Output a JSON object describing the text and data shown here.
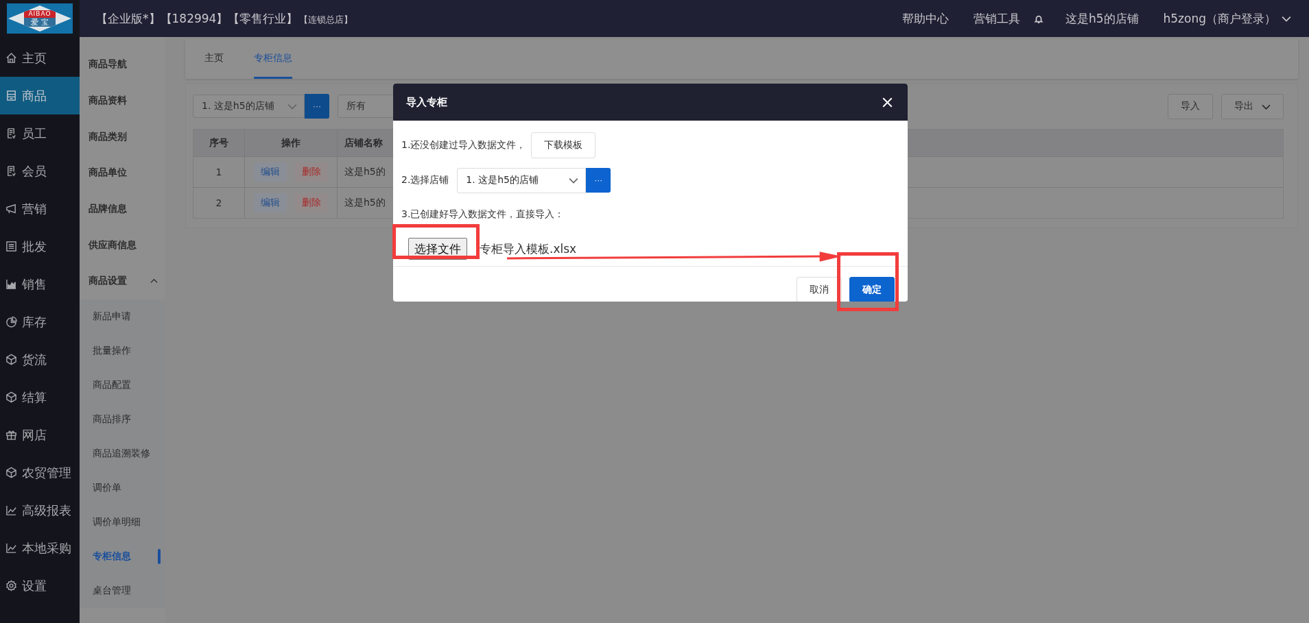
{
  "header": {
    "logo": {
      "top": "AIBAO",
      "bottom": "爱 宝"
    },
    "title_parts": [
      "【企业版*】",
      "【182994】",
      "【零售行业】"
    ],
    "title_note": "【连锁总店】",
    "links": [
      "帮助中心",
      "营销工具"
    ],
    "store": "这是h5的店铺",
    "user": "h5zong（商户登录）"
  },
  "nav": [
    {
      "label": "主页",
      "kind": "home",
      "selected": false
    },
    {
      "label": "商品",
      "kind": "box",
      "selected": true
    },
    {
      "label": "员工",
      "kind": "doc",
      "selected": false
    },
    {
      "label": "会员",
      "kind": "doc",
      "selected": false
    },
    {
      "label": "营销",
      "kind": "horn",
      "selected": false
    },
    {
      "label": "批发",
      "kind": "list",
      "selected": false
    },
    {
      "label": "销售",
      "kind": "area",
      "selected": false
    },
    {
      "label": "库存",
      "kind": "pie",
      "selected": false
    },
    {
      "label": "货流",
      "kind": "cube",
      "selected": false
    },
    {
      "label": "结算",
      "kind": "cube",
      "selected": false
    },
    {
      "label": "网店",
      "kind": "gift",
      "selected": false
    },
    {
      "label": "农贸管理",
      "kind": "cube",
      "selected": false
    },
    {
      "label": "高级报表",
      "kind": "line",
      "selected": false
    },
    {
      "label": "本地采购",
      "kind": "line",
      "selected": false
    },
    {
      "label": "设置",
      "kind": "gear",
      "selected": false
    }
  ],
  "subnav": [
    {
      "label": "商品导航",
      "selected": false
    },
    {
      "label": "商品资料",
      "selected": false
    },
    {
      "label": "商品类别",
      "selected": false
    },
    {
      "label": "商品单位",
      "selected": false
    },
    {
      "label": "品牌信息",
      "selected": false
    },
    {
      "label": "供应商信息",
      "selected": false
    },
    {
      "label": "商品设置",
      "selected": false,
      "expanded": true,
      "children": [
        {
          "label": "新品申请",
          "selected": false
        },
        {
          "label": "批量操作",
          "selected": false
        },
        {
          "label": "商品配置",
          "selected": false
        },
        {
          "label": "商品排序",
          "selected": false
        },
        {
          "label": "商品追溯装修",
          "selected": false
        },
        {
          "label": "调价单",
          "selected": false
        },
        {
          "label": "调价单明细",
          "selected": false
        },
        {
          "label": "专柜信息",
          "selected": true
        },
        {
          "label": "桌台管理",
          "selected": false
        }
      ]
    }
  ],
  "tabs": [
    {
      "label": "主页",
      "selected": false
    },
    {
      "label": "专柜信息",
      "selected": true
    }
  ],
  "toolbar": {
    "store_select": "1. 这是h5的店铺",
    "more_button": "···",
    "filter_select": "所有",
    "buttons": [
      {
        "label": "导入",
        "kind": "plain"
      },
      {
        "label": "导出",
        "kind": "dropdown"
      }
    ]
  },
  "table": {
    "columns": [
      "序号",
      "操作",
      "店铺名称"
    ],
    "rows": [
      {
        "index": "1",
        "actions": [
          "编辑",
          "删除"
        ],
        "store": "这是h5的"
      },
      {
        "index": "2",
        "actions": [
          "编辑",
          "删除"
        ],
        "store": "这是h5的"
      }
    ]
  },
  "dialog": {
    "title": "导入专柜",
    "step1": "1.还没创建过导入数据文件，",
    "download_button": "下载模板",
    "step2": "2.选择店铺",
    "store_select": "1. 这是h5的店铺",
    "more_button": "···",
    "step3": "3.已创建好导入数据文件，直接导入：",
    "file_button": "选择文件",
    "file_name": "专柜导入模板.xlsx",
    "buttons": [
      {
        "label": "取消",
        "kind": "plain"
      },
      {
        "label": "确定",
        "kind": "primary"
      }
    ]
  }
}
